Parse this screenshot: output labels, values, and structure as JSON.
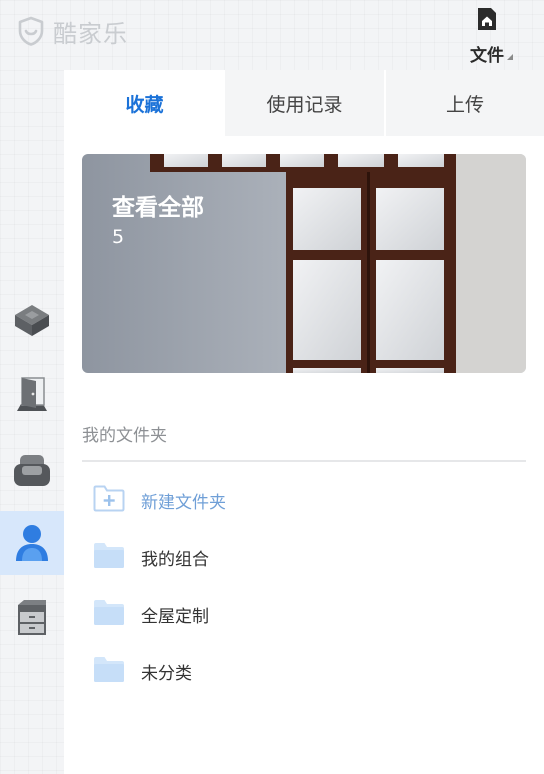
{
  "header": {
    "logo_text": "酷家乐",
    "logo_icon": "shield-smile-icon",
    "file_label": "文件",
    "file_icon": "home-document-icon"
  },
  "rail": {
    "items": [
      {
        "name": "rail-item-structure",
        "icon": "cube-icon",
        "active": false
      },
      {
        "name": "rail-item-door",
        "icon": "door-icon",
        "active": false
      },
      {
        "name": "rail-item-furniture",
        "icon": "sofa-icon",
        "active": false
      },
      {
        "name": "rail-item-mine",
        "icon": "user-icon",
        "active": true
      },
      {
        "name": "rail-item-cabinet",
        "icon": "cabinet-icon",
        "active": false
      }
    ]
  },
  "tabs": [
    {
      "label": "收藏",
      "active": true
    },
    {
      "label": "使用记录",
      "active": false
    },
    {
      "label": "上传",
      "active": false
    }
  ],
  "banner": {
    "title": "查看全部",
    "count": "5"
  },
  "folders": {
    "section_title": "我的文件夹",
    "new_folder_label": "新建文件夹",
    "items": [
      {
        "label": "我的组合"
      },
      {
        "label": "全屋定制"
      },
      {
        "label": "未分类"
      }
    ]
  },
  "colors": {
    "accent": "#1b72d8",
    "active_rail_bg": "#d7e7fb",
    "folder_icon": "#d3e6fa",
    "muted_text": "#8d9094"
  }
}
